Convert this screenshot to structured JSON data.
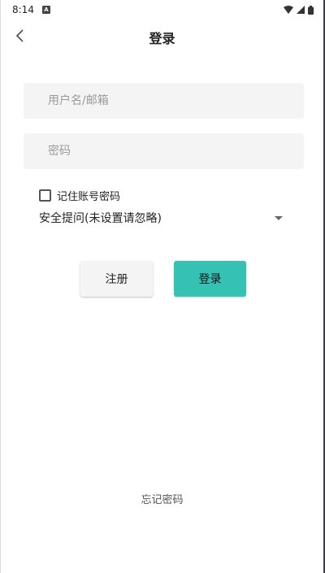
{
  "status_bar": {
    "time": "8:14",
    "notification_icon": "A"
  },
  "app_bar": {
    "title": "登录",
    "back_icon": "chevron-left-icon"
  },
  "form": {
    "username_placeholder": "用户名/邮箱",
    "password_placeholder": "密码",
    "remember_label": "记住账号密码",
    "remember_checked": false,
    "security_question": "安全提问(未设置请忽略)"
  },
  "buttons": {
    "register_label": "注册",
    "login_label": "登录"
  },
  "footer": {
    "forgot_label": "忘记密码"
  },
  "colors": {
    "accent": "#35c2b4",
    "field_bg": "#f4f4f4"
  }
}
